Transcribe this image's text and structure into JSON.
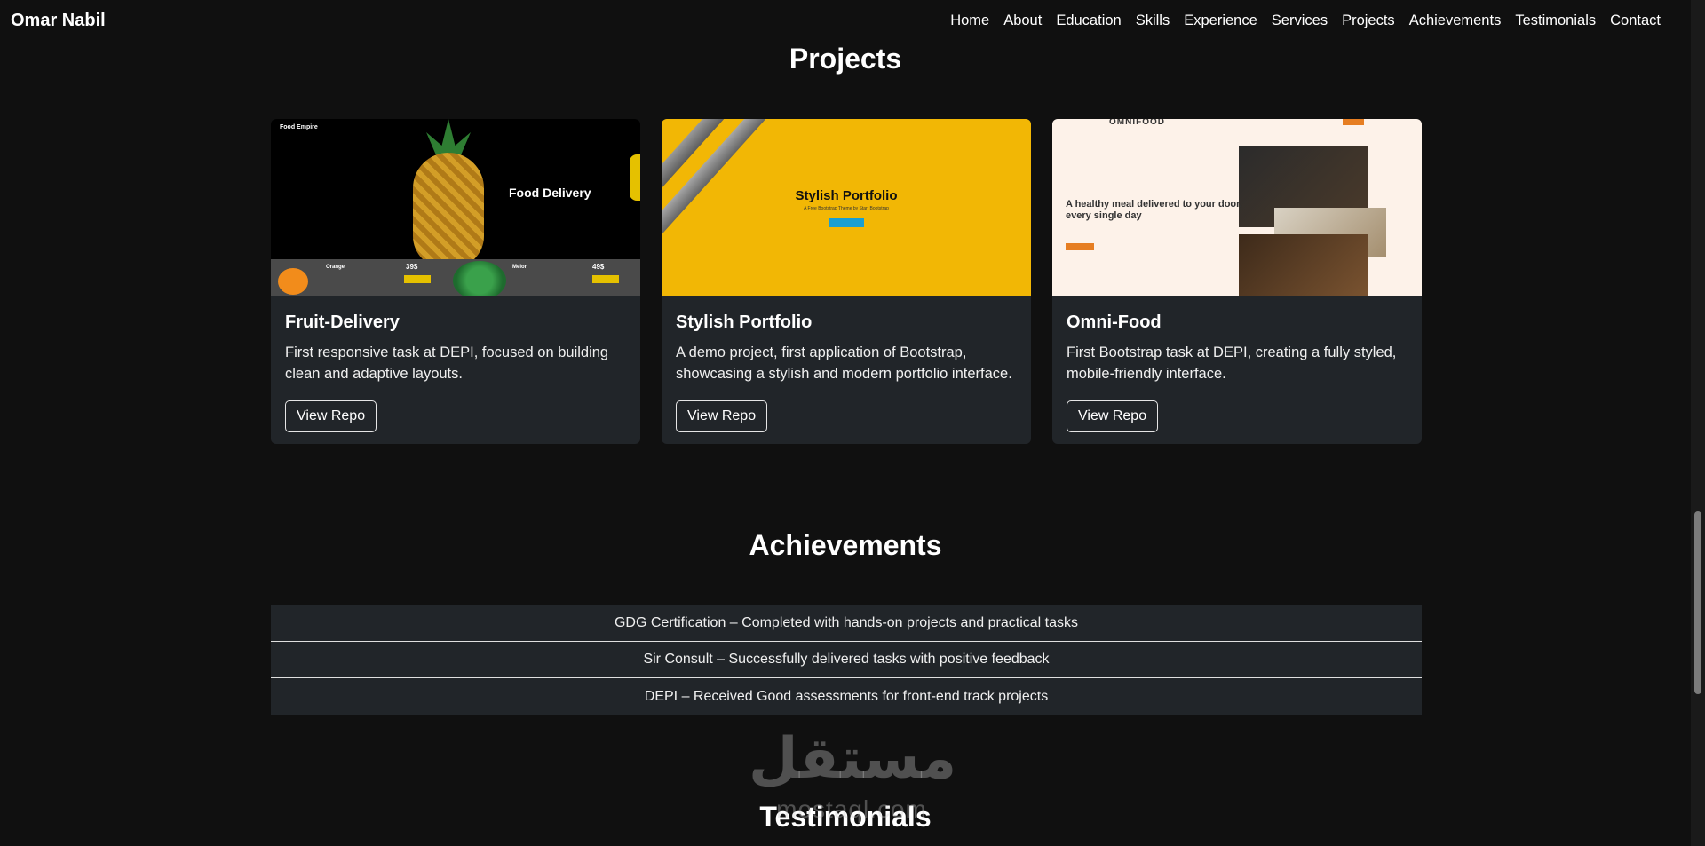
{
  "navbar": {
    "brand": "Omar Nabil",
    "links": [
      "Home",
      "About",
      "Education",
      "Skills",
      "Experience",
      "Services",
      "Projects",
      "Achievements",
      "Testimonials",
      "Contact"
    ]
  },
  "projects": {
    "title": "Projects",
    "cards": [
      {
        "title": "Fruit-Delivery",
        "text": "First responsive task at DEPI, focused on building clean and adaptive layouts.",
        "button": "View Repo",
        "thumb": {
          "brand": "Food Empire",
          "price1": "39$",
          "price2": "49$",
          "headline": "Food Delivery",
          "label1": "Orange",
          "label2": "Melon"
        }
      },
      {
        "title": "Stylish Portfolio",
        "text": "A demo project, first application of Bootstrap, showcasing a stylish and modern portfolio interface.",
        "button": "View Repo",
        "thumb": {
          "headline": "Stylish Portfolio",
          "sub": "A Free Bootstrap Theme by Start Bootstrap"
        }
      },
      {
        "title": "Omni-Food",
        "text": "First Bootstrap task at DEPI, creating a fully styled, mobile-friendly interface.",
        "button": "View Repo",
        "thumb": {
          "logo": "OMNIFOOD",
          "headline": "A healthy meal delivered to your door, every single day"
        }
      }
    ]
  },
  "achievements": {
    "title": "Achievements",
    "items": [
      "GDG Certification – Completed with hands-on projects and practical tasks",
      "Sir Consult – Successfully delivered tasks with positive feedback",
      "DEPI – Received Good assessments for front-end track projects"
    ]
  },
  "testimonials": {
    "title": "Testimonials"
  },
  "watermark": {
    "main": "مستقل",
    "sub": "mostaql.com"
  }
}
